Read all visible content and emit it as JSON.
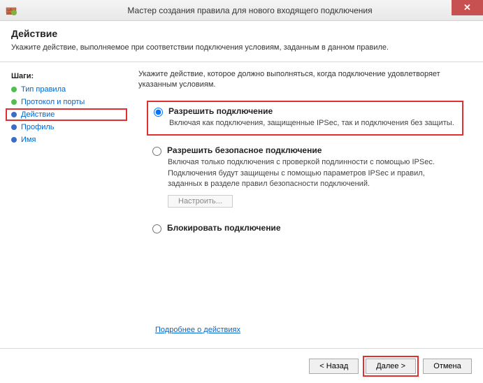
{
  "titlebar": {
    "title": "Мастер создания правила для нового входящего подключения",
    "close": "✕"
  },
  "header": {
    "title": "Действие",
    "desc": "Укажите действие, выполняемое при соответствии подключения условиям, заданным в данном правиле."
  },
  "sidebar": {
    "heading": "Шаги:",
    "steps": [
      {
        "label": "Тип правила",
        "color": "#4fbf4f"
      },
      {
        "label": "Протокол и порты",
        "color": "#4fbf4f"
      },
      {
        "label": "Действие",
        "color": "#3a6cc9",
        "highlighted": true
      },
      {
        "label": "Профиль",
        "color": "#3a6cc9"
      },
      {
        "label": "Имя",
        "color": "#3a6cc9"
      }
    ]
  },
  "main": {
    "instruction": "Укажите действие, которое должно выполняться, когда подключение удовлетворяет указанным условиям.",
    "options": [
      {
        "title": "Разрешить подключение",
        "desc": "Включая как подключения, защищенные IPSec, так и подключения без защиты.",
        "selected": true,
        "highlighted": true
      },
      {
        "title": "Разрешить безопасное подключение",
        "desc": "Включая только подключения с проверкой подлинности с помощью IPSec. Подключения будут защищены с помощью параметров IPSec и правил, заданных в разделе правил безопасности подключений.",
        "config_btn": "Настроить..."
      },
      {
        "title": "Блокировать подключение"
      }
    ],
    "learn_more": "Подробнее о действиях"
  },
  "footer": {
    "back": "< Назад",
    "next": "Далее >",
    "cancel": "Отмена"
  }
}
